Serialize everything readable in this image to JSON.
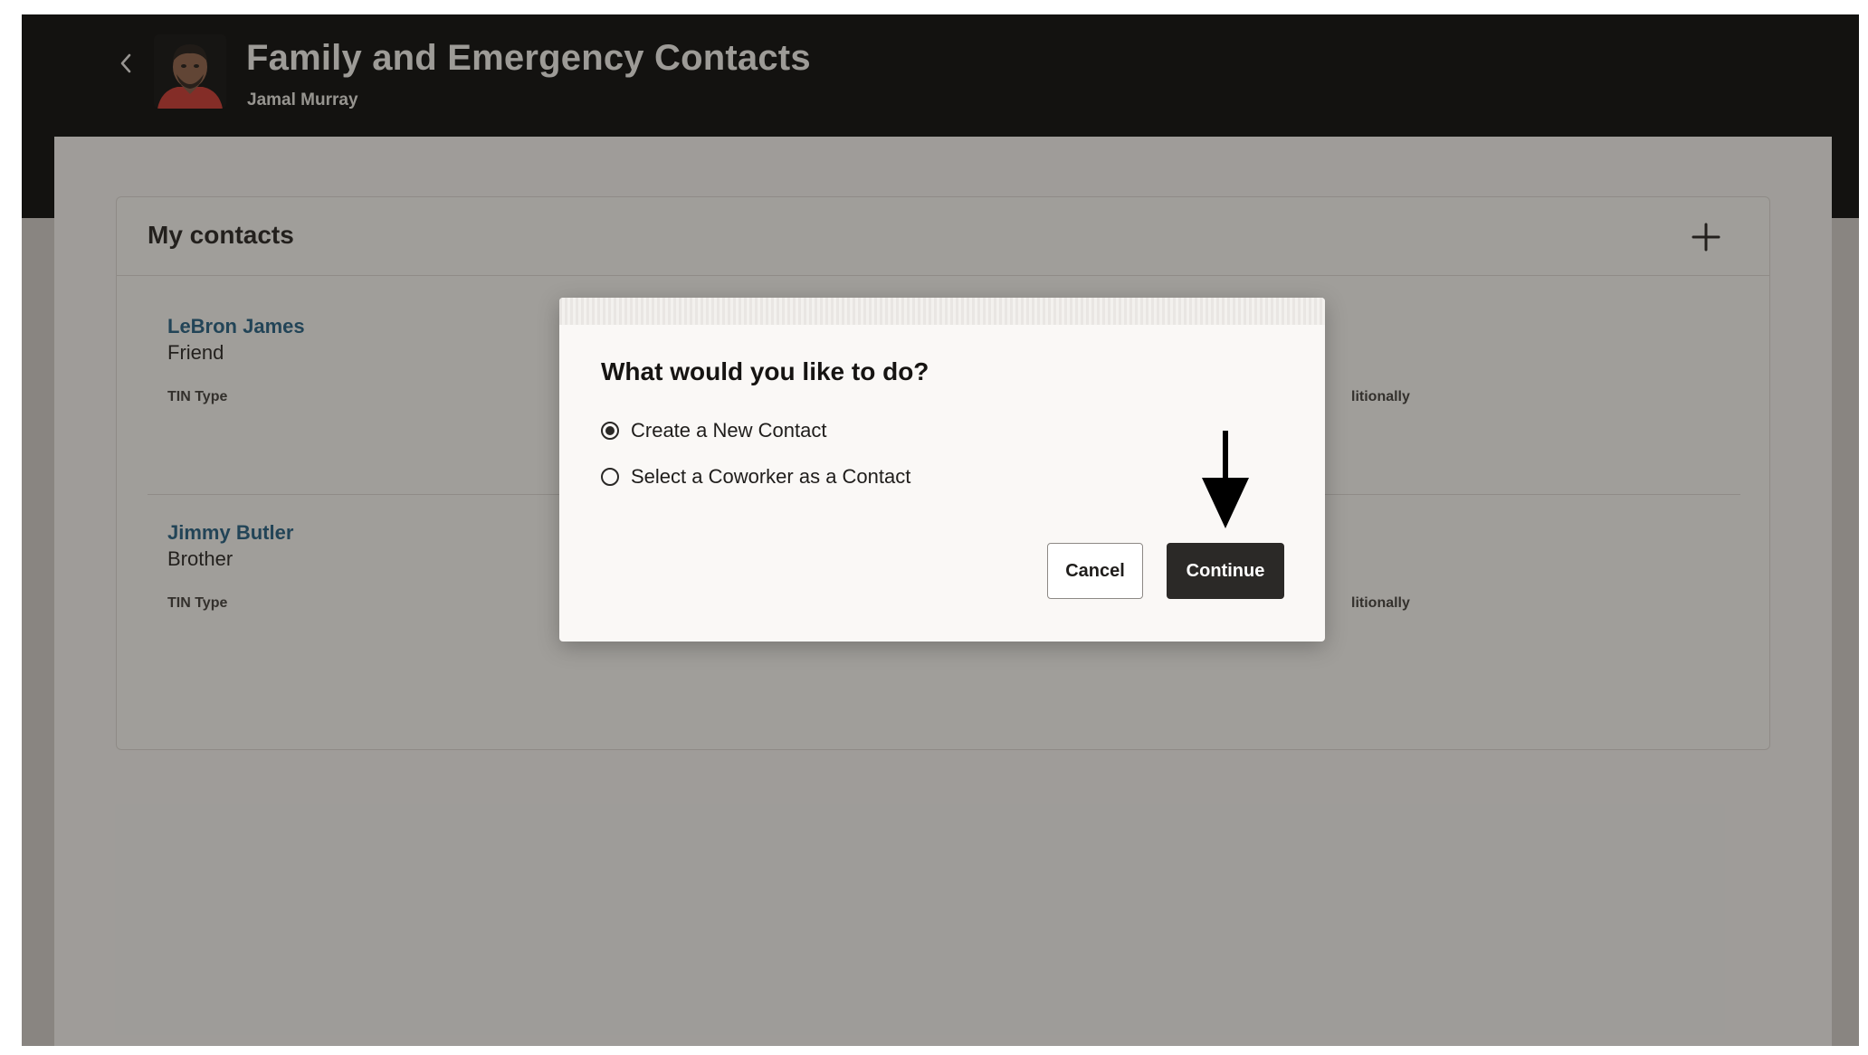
{
  "header": {
    "title": "Family and Emergency Contacts",
    "subtitle": "Jamal Murray",
    "back_icon": "chevron-left-icon"
  },
  "contacts_card": {
    "title": "My contacts",
    "add_icon": "plus-icon",
    "contacts": [
      {
        "name": "LeBron James",
        "relationship": "Friend",
        "tin_label": "TIN Type",
        "extra_label": "litionally"
      },
      {
        "name": "Jimmy Butler",
        "relationship": "Brother",
        "tin_label": "TIN Type",
        "extra_label": "litionally"
      }
    ]
  },
  "dialog": {
    "title": "What would you like to do?",
    "options": [
      {
        "label": "Create a New Contact",
        "selected": true
      },
      {
        "label": "Select a Coworker as a Contact",
        "selected": false
      }
    ],
    "cancel_label": "Cancel",
    "continue_label": "Continue"
  },
  "colors": {
    "header_bg": "#050505",
    "link": "#1e5a7e",
    "primary_button": "#2b2927"
  }
}
